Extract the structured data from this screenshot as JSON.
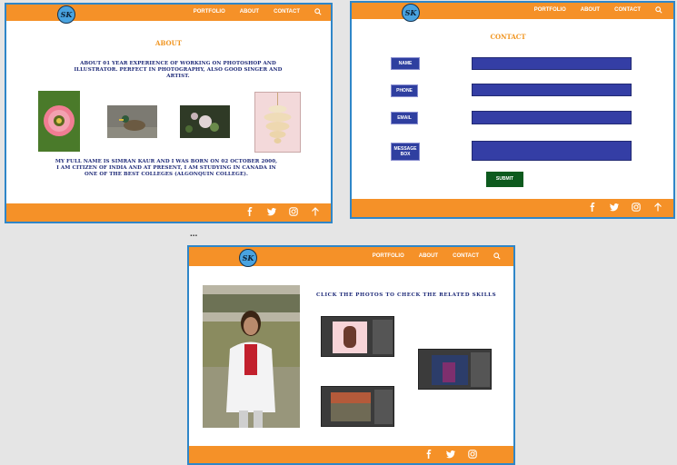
{
  "logo_text": "SK",
  "nav": {
    "portfolio": "PORTFOLIO",
    "about": "ABOUT",
    "contact": "CONTACT",
    "search_icon": "search-icon"
  },
  "footer_icons": [
    "facebook-icon",
    "twitter-icon",
    "instagram-icon",
    "arrow-up-icon"
  ],
  "about_page": {
    "heading": "ABOUT",
    "intro": "ABOUT 01 YEAR EXPERIENCE OF WORKING ON PHOTOSHOP AND ILLUSTRATOR. PERFECT IN PHOTOGRAPHY, ALSO GOOD SINGER AND ARTIST.",
    "bio": "MY FULL NAME IS SIMRAN KAUR AND I WAS BORN ON 02 OCTOBER 2000, I AM CITIZEN OF INDIA AND AT PRESENT, I AM STUDYING IN CANADA IN ONE OF THE BEST COLLEGES (ALGONQUIN COLLEGE)."
  },
  "contact_page": {
    "heading": "CONTACT",
    "fields": {
      "name": "NAME",
      "phone": "PHONE",
      "email": "EMAIL",
      "message_line1": "MESSAGE",
      "message_line2": "BOX"
    },
    "submit": "SUBMIT"
  },
  "ellipsis": "...",
  "portfolio_page": {
    "instruction": "CLICK THE PHOTOS TO CHECK THE RELATED SKILLS"
  },
  "colors": {
    "orange": "#f59128",
    "blue_border": "#2f86c8",
    "navy_text": "#1e2a78",
    "input_blue": "#343ea5",
    "submit_green": "#0d5a1e"
  }
}
